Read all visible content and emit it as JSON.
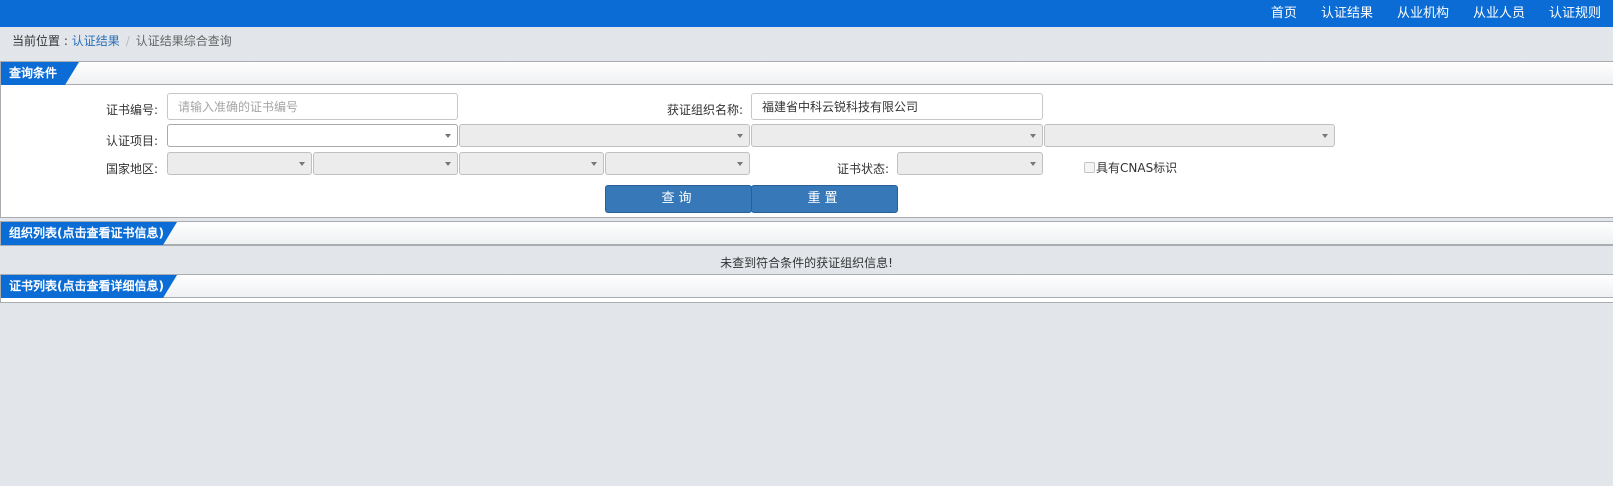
{
  "nav": {
    "items": [
      "首页",
      "认证结果",
      "从业机构",
      "从业人员",
      "认证规则"
    ]
  },
  "breadcrumb": {
    "prefix": "当前位置 : ",
    "link": "认证结果",
    "current": "认证结果综合查询"
  },
  "query_panel": {
    "title": "查询条件",
    "cert_no_label": "证书编号:",
    "cert_no_placeholder": "请输入准确的证书编号",
    "cert_no_value": "",
    "org_name_label": "获证组织名称:",
    "org_name_value": "福建省中科云锐科技有限公司",
    "project_label": "认证项目:",
    "region_label": "国家地区:",
    "status_label": "证书状态:",
    "cnas_label": "具有CNAS标识",
    "query_button": "查询",
    "reset_button": "重置"
  },
  "org_panel": {
    "title": "组织列表(点击查看证书信息)",
    "empty_message": "未查到符合条件的获证组织信息!"
  },
  "cert_panel": {
    "title": "证书列表(点击查看详细信息)"
  },
  "colors": {
    "brand_blue": "#0a6cd4",
    "button_blue": "#3778b8",
    "page_bg": "#e2e6ea"
  },
  "icons": {
    "select_caret": "chevron-down-icon",
    "checkbox": "checkbox-icon"
  }
}
